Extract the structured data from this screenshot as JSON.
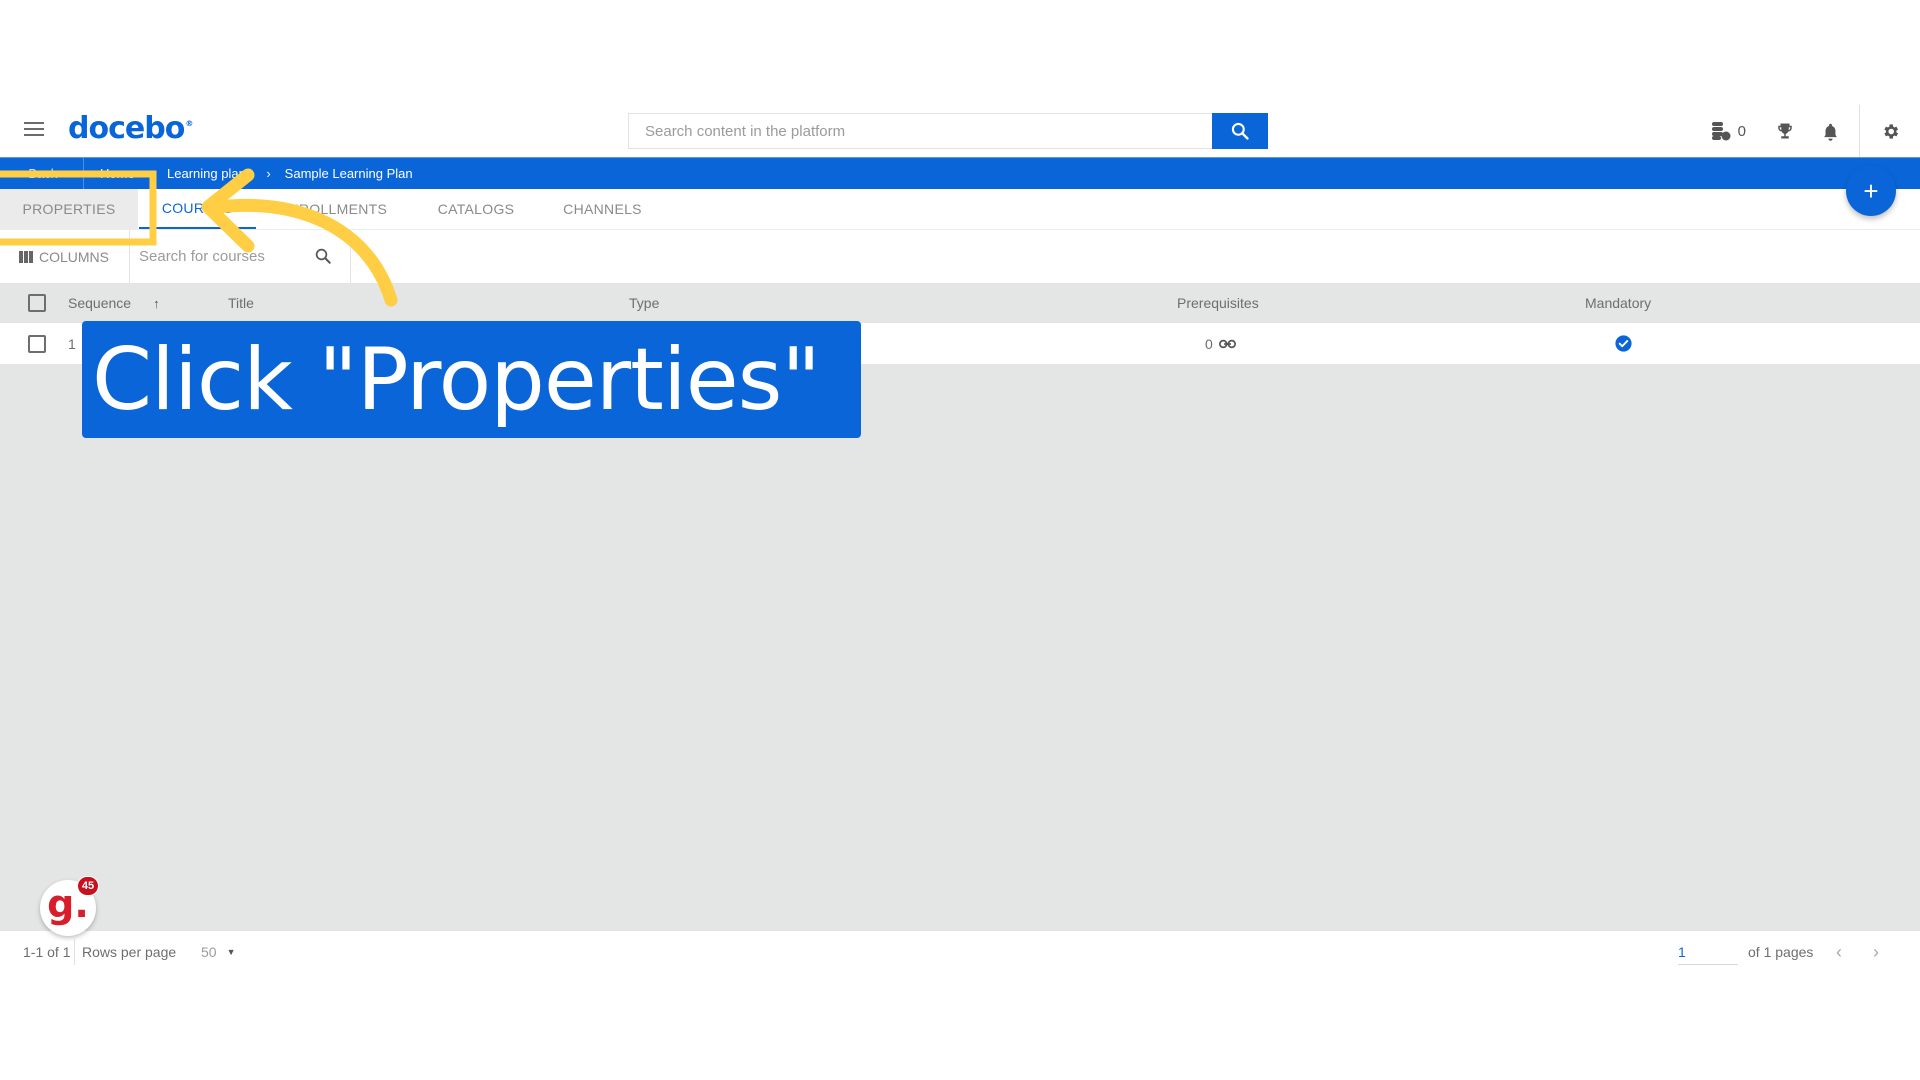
{
  "header": {
    "logo_text": "docebo",
    "logo_mark": "®",
    "search_placeholder": "Search content in the platform",
    "credits_count": "0",
    "icons": [
      "menu-icon",
      "search-icon",
      "coins-icon",
      "trophy-icon",
      "bell-icon",
      "gear-icon"
    ]
  },
  "breadcrumb": {
    "back_label": "Back",
    "items": [
      "Home",
      "Learning plans",
      "Sample Learning Plan"
    ]
  },
  "tabs": [
    {
      "label": "PROPERTIES",
      "active": false,
      "hovered": true
    },
    {
      "label": "COURSES",
      "active": true
    },
    {
      "label": "ENROLLMENTS",
      "active": false
    },
    {
      "label": "CATALOGS",
      "active": false
    },
    {
      "label": "CHANNELS",
      "active": false
    }
  ],
  "toolbar": {
    "columns_label": "COLUMNS",
    "search_placeholder": "Search for courses"
  },
  "table": {
    "columns": [
      "Sequence",
      "Title",
      "Type",
      "Prerequisites",
      "Mandatory"
    ],
    "sort": {
      "column": "Sequence",
      "direction": "ascending"
    },
    "rows": [
      {
        "sequence": "1",
        "title": "",
        "type": "",
        "prerequisites": "0",
        "mandatory": true
      }
    ]
  },
  "footer": {
    "range": "1-1 of 1",
    "rows_per_page_label": "Rows per page",
    "rows_per_page_value": "50",
    "page_value": "1",
    "of_pages": "of 1 pages"
  },
  "badge": {
    "letter": "g.",
    "count": "45"
  },
  "tutorial": {
    "callout_text": "Click \"Properties\"",
    "accent_color": "#FFCE44"
  },
  "colors": {
    "brand": "#0A66D8",
    "content_bg": "#E4E5E5",
    "badge_red": "#D81E2A"
  }
}
